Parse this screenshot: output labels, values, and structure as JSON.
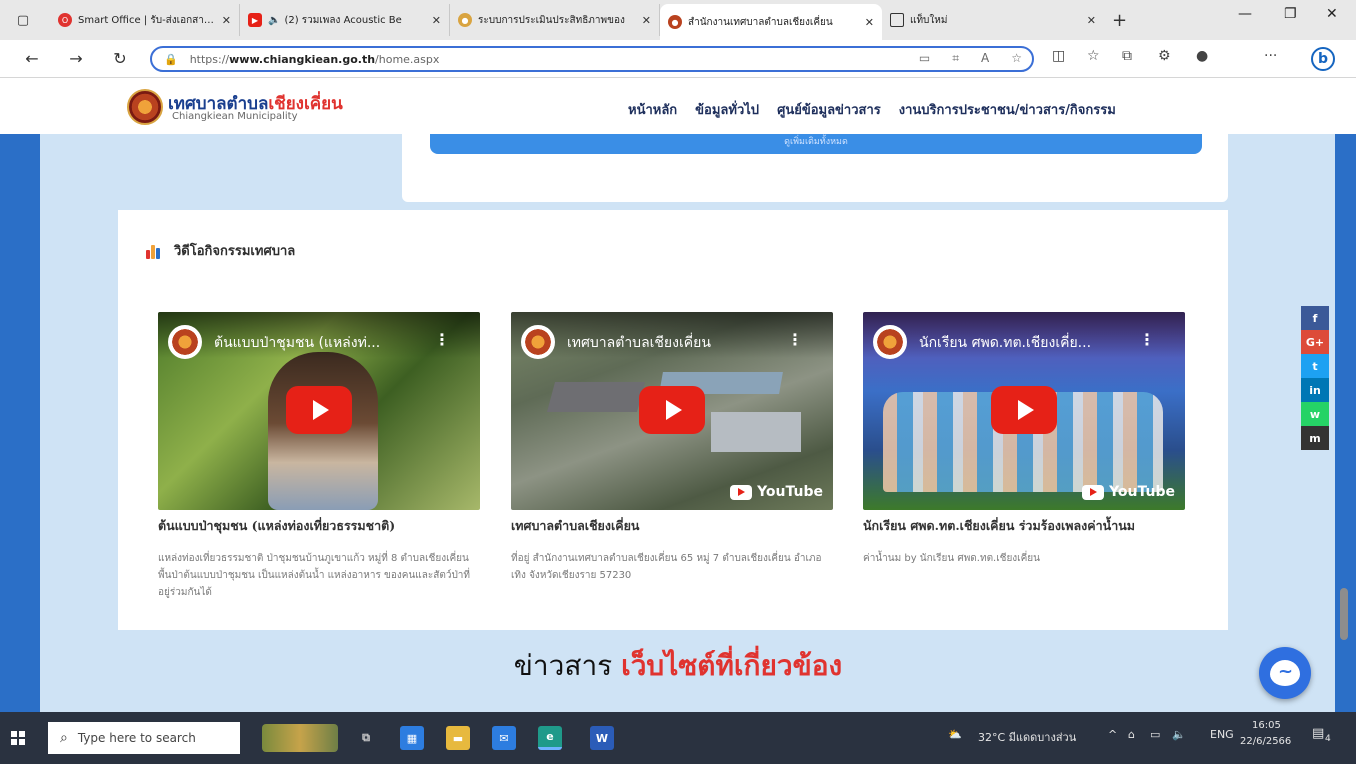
{
  "browser": {
    "tabs": [
      {
        "label": "Smart Office | รับ-ส่งเอกสารอิเล็",
        "active": false
      },
      {
        "label": "(2) รวมเพลง Acoustic Be",
        "active": false
      },
      {
        "label": "ระบบการประเมินประสิทธิภาพของ",
        "active": false
      },
      {
        "label": "สำนักงานเทศบาลตำบลเชียงเคี่ยน",
        "active": true
      },
      {
        "label": "แท็บใหม่",
        "active": false
      }
    ],
    "url_scheme": "https://",
    "url_host": "www.chiangkiean.go.th",
    "url_path": "/home.aspx",
    "bing_label": "b"
  },
  "site": {
    "logo_th_main": "เทศบาลตำบล",
    "logo_th_accent": "เชียงเคี่ยน",
    "logo_en": "Chiangkiean Municipality",
    "nav": [
      "หน้าหลัก",
      "ข้อมูลทั่วไป",
      "ศูนย์ข้อมูลข่าวสาร",
      "งานบริการประชาชน/ข่าวสาร/กิจกรรม"
    ],
    "blue_button_label": "ดูเพิ่มเติมทั้งหมด"
  },
  "videos_section": {
    "title": "วิดีโอกิจกรรมเทศบาล",
    "videos": [
      {
        "overlay_title": "ต้นแบบป่าชุมชน (แหล่งท่...",
        "heading": "ต้นแบบป่าชุมชน (แหล่งท่องเที่ยวธรรมชาติ)",
        "description": "แหล่งท่องเที่ยวธรรมชาติ ป่าชุมชนบ้านภูเขาแก้ว หมู่ที่ 8 ตำบลเชียงเคี่ยน พื้นป่าต้นแบบป่าชุมชน เป็นแหล่งต้นน้ำ แหล่งอาหาร ของคนและสัตว์ป่าที่อยู่ร่วมกันได้",
        "show_youtube_badge": false
      },
      {
        "overlay_title": "เทศบาลตำบลเชียงเคี่ยน",
        "heading": "เทศบาลตำบลเชียงเคี่ยน",
        "description": "ที่อยู่ สำนักงานเทศบาลตำบลเชียงเคี่ยน 65 หมู่ 7 ตำบลเชียงเคี่ยน อำเภอเทิง จังหวัดเชียงราย 57230",
        "show_youtube_badge": true
      },
      {
        "overlay_title": "นักเรียน ศพด.ทต.เชียงเคี่ย...",
        "heading": "นักเรียน ศพด.ทต.เชียงเคี่ยน ร่วมร้องเพลงค่าน้ำนม",
        "description": "ค่าน้ำนม by นักเรียน ศพด.ทต.เชียงเคี่ยน",
        "show_youtube_badge": true
      }
    ],
    "youtube_label": "YouTube"
  },
  "news": {
    "title_dark": "ข่าวสาร",
    "title_red": "เว็บไซต์ที่เกี่ยวข้อง"
  },
  "social": [
    "f",
    "G+",
    "t",
    "in",
    "w",
    "m"
  ],
  "taskbar": {
    "search_placeholder": "Type here to search",
    "weather": "32°C มีแดดบางส่วน",
    "lang": "ENG",
    "time": "16:05",
    "date": "22/6/2566",
    "notification_count": "4"
  },
  "colors": {
    "brand_blue": "#2b6fc7",
    "accent_red": "#e0332f",
    "play_red": "#e62117"
  }
}
